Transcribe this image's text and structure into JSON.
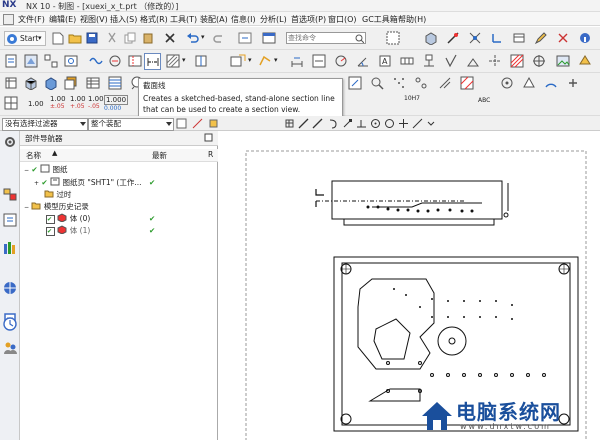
{
  "window": {
    "app_logo": "NX",
    "title": "NX 10 - 制图 - [xuexi_x_t.prt （修改的）]"
  },
  "menu": {
    "items": [
      "文件(F)",
      "编辑(E)",
      "视图(V)",
      "插入(S)",
      "格式(R)",
      "工具(T)",
      "装配(A)",
      "信息(I)",
      "分析(L)",
      "首选项(P)",
      "窗口(O)",
      "GC工具箱",
      "帮助(H)"
    ]
  },
  "toolbar": {
    "start_label": "Start",
    "search_placeholder": "查找命令",
    "table_labels": [
      "1.00",
      "1.00",
      "1.00",
      "1.00",
      "1.000"
    ]
  },
  "tooltip": {
    "title": "截面线",
    "lines": [
      "Creates a sketched-based, stand-alone section line",
      "that can be used to create a section view."
    ]
  },
  "filters": {
    "selection_filter": "没有选择过滤器",
    "scope": "整个装配"
  },
  "navigator": {
    "title": "部件导航器",
    "col_name": "名称",
    "col_latest": "最新",
    "col_extra": "R",
    "tree": [
      {
        "label": "图纸",
        "latest": ""
      },
      {
        "label": "图纸页 \"SHT1\" (工作...",
        "latest": "✔"
      },
      {
        "label": "过时",
        "latest": ""
      },
      {
        "label": "模型历史记录",
        "latest": ""
      },
      {
        "label": "体 (0)",
        "latest": "✔"
      },
      {
        "label": "体 (1)",
        "latest": "✔"
      }
    ]
  },
  "watermark": {
    "brand": "电脑系统网",
    "url": "www.dnxtw.com"
  },
  "colors": {
    "accent_blue": "#1a4f9c",
    "check_green": "#2a9a2a"
  }
}
